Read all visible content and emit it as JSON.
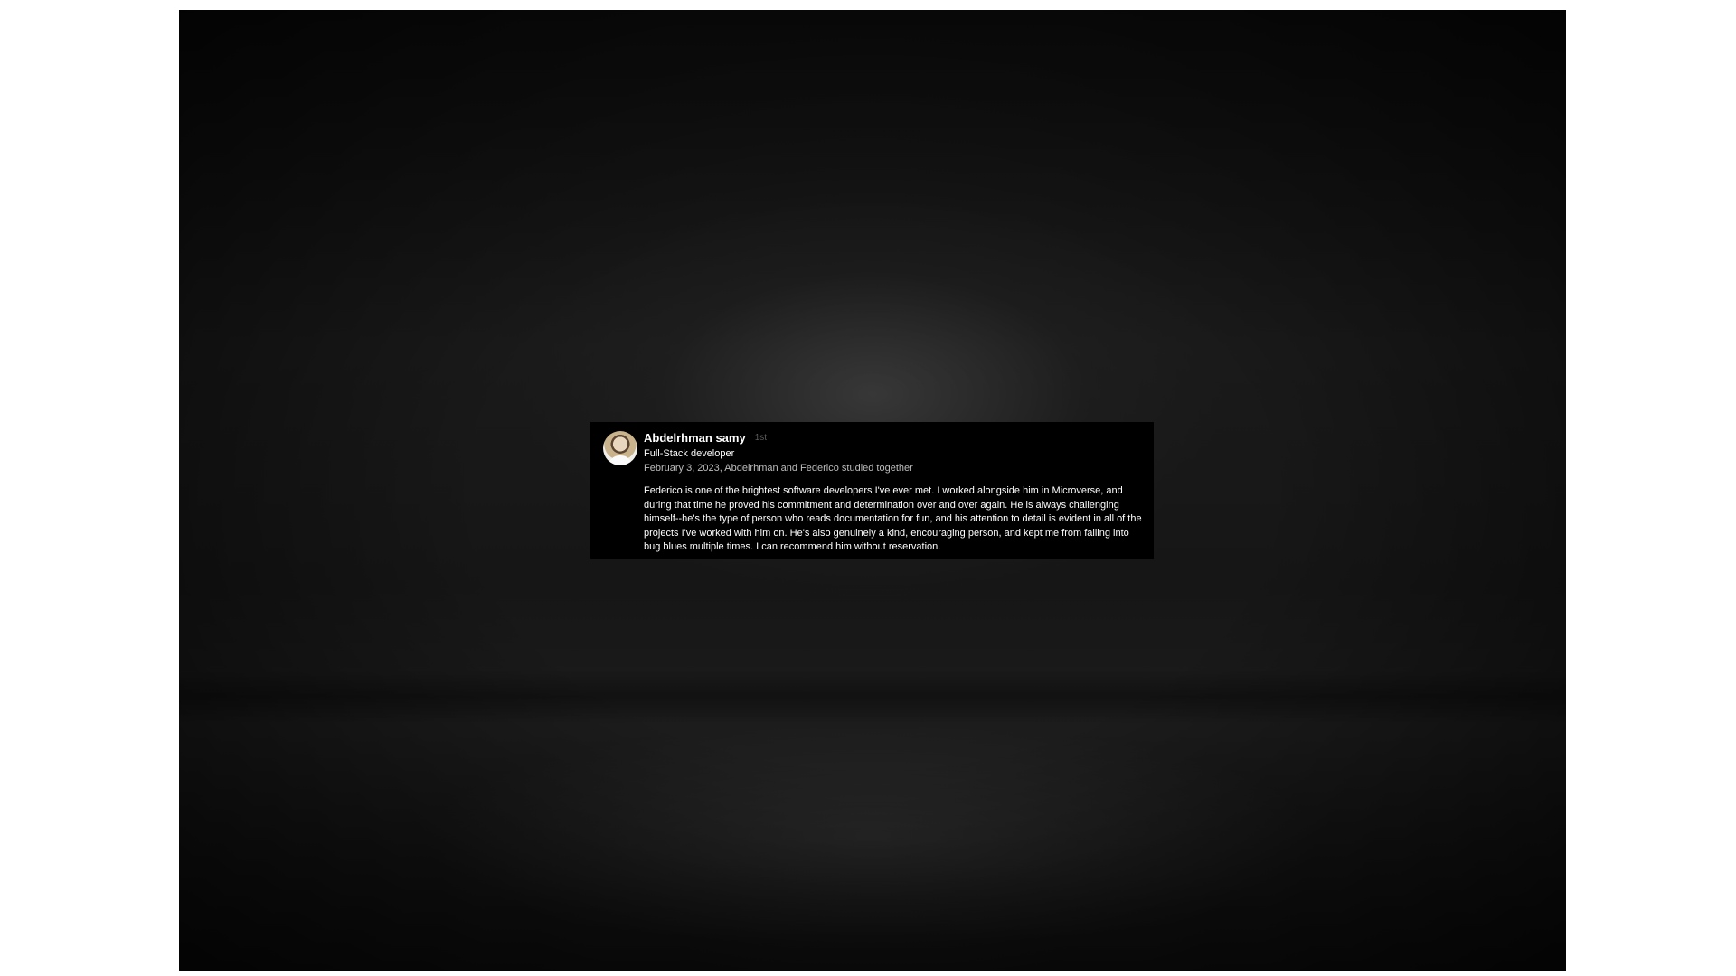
{
  "recommendation": {
    "author_name": "Abdelrhman samy",
    "degree": "1st",
    "headline": "Full-Stack developer",
    "meta": "February 3, 2023, Abdelrhman and Federico studied together",
    "text": "Federico is one of the brightest software developers I've ever met. I worked alongside him in Microverse, and during that time he proved his commitment and determination over and over again. He is always challenging himself--he's the type of person who reads documentation for fun, and his attention to detail is evident in all of the projects I've worked with him on. He's also genuinely a kind, encouraging person, and kept me from falling into bug blues multiple times. I can recommend him without reservation."
  },
  "colors": {
    "card_background": "#000000",
    "page_background": "#ffffff",
    "stage_background": "#141414",
    "text_primary": "#ffffff",
    "text_secondary": "#bdbdbd"
  }
}
